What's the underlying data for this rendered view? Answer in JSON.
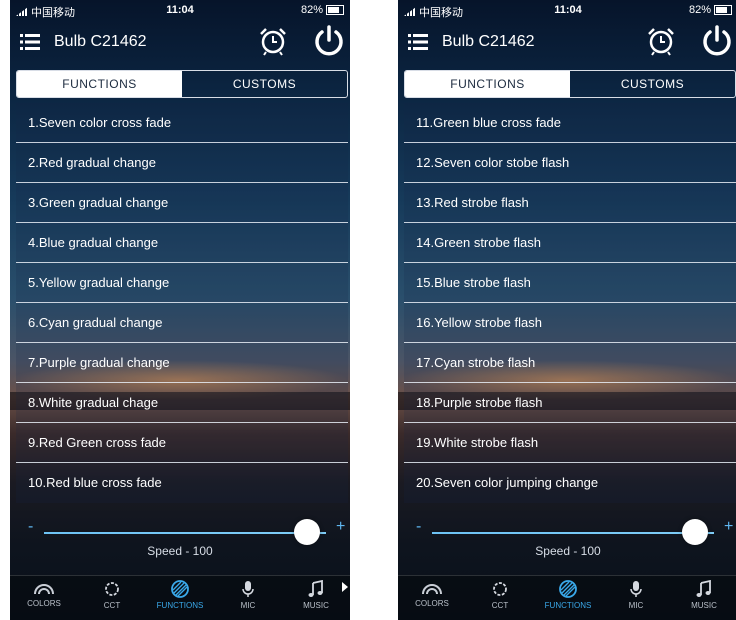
{
  "status_bar": {
    "carrier": "中国移动",
    "time": "11:04",
    "battery": "82%"
  },
  "header": {
    "title": "Bulb C21462"
  },
  "tabs": [
    {
      "label": "FUNCTIONS"
    },
    {
      "label": "CUSTOMS"
    }
  ],
  "left_list": [
    "1.Seven color cross fade",
    "2.Red gradual change",
    "3.Green gradual change",
    "4.Blue gradual change",
    "5.Yellow gradual change",
    "6.Cyan gradual change",
    "7.Purple gradual change",
    "8.White gradual chage",
    "9.Red Green cross fade",
    "10.Red blue cross fade"
  ],
  "right_list": [
    "11.Green blue cross fade",
    "12.Seven color stobe flash",
    "13.Red strobe flash",
    "14.Green strobe flash",
    "15.Blue strobe flash",
    "16.Yellow strobe flash",
    "17.Cyan strobe flash",
    "18.Purple strobe flash",
    "19.White strobe flash",
    "20.Seven color jumping change"
  ],
  "speed": {
    "minus": "-",
    "plus": "+",
    "label": "Speed - 100",
    "value": 100,
    "max": 100
  },
  "nav": [
    {
      "label": "COLORS",
      "icon": "rainbow-icon"
    },
    {
      "label": "CCT",
      "icon": "sun-icon"
    },
    {
      "label": "FUNCTIONS",
      "icon": "functions-icon"
    },
    {
      "label": "MIC",
      "icon": "microphone-icon"
    },
    {
      "label": "MUSIC",
      "icon": "music-note-icon"
    }
  ],
  "colors": {
    "accent": "#3aa9ea",
    "tab_active_bg": "#ffffff",
    "tab_active_text": "#1b2a3e"
  }
}
